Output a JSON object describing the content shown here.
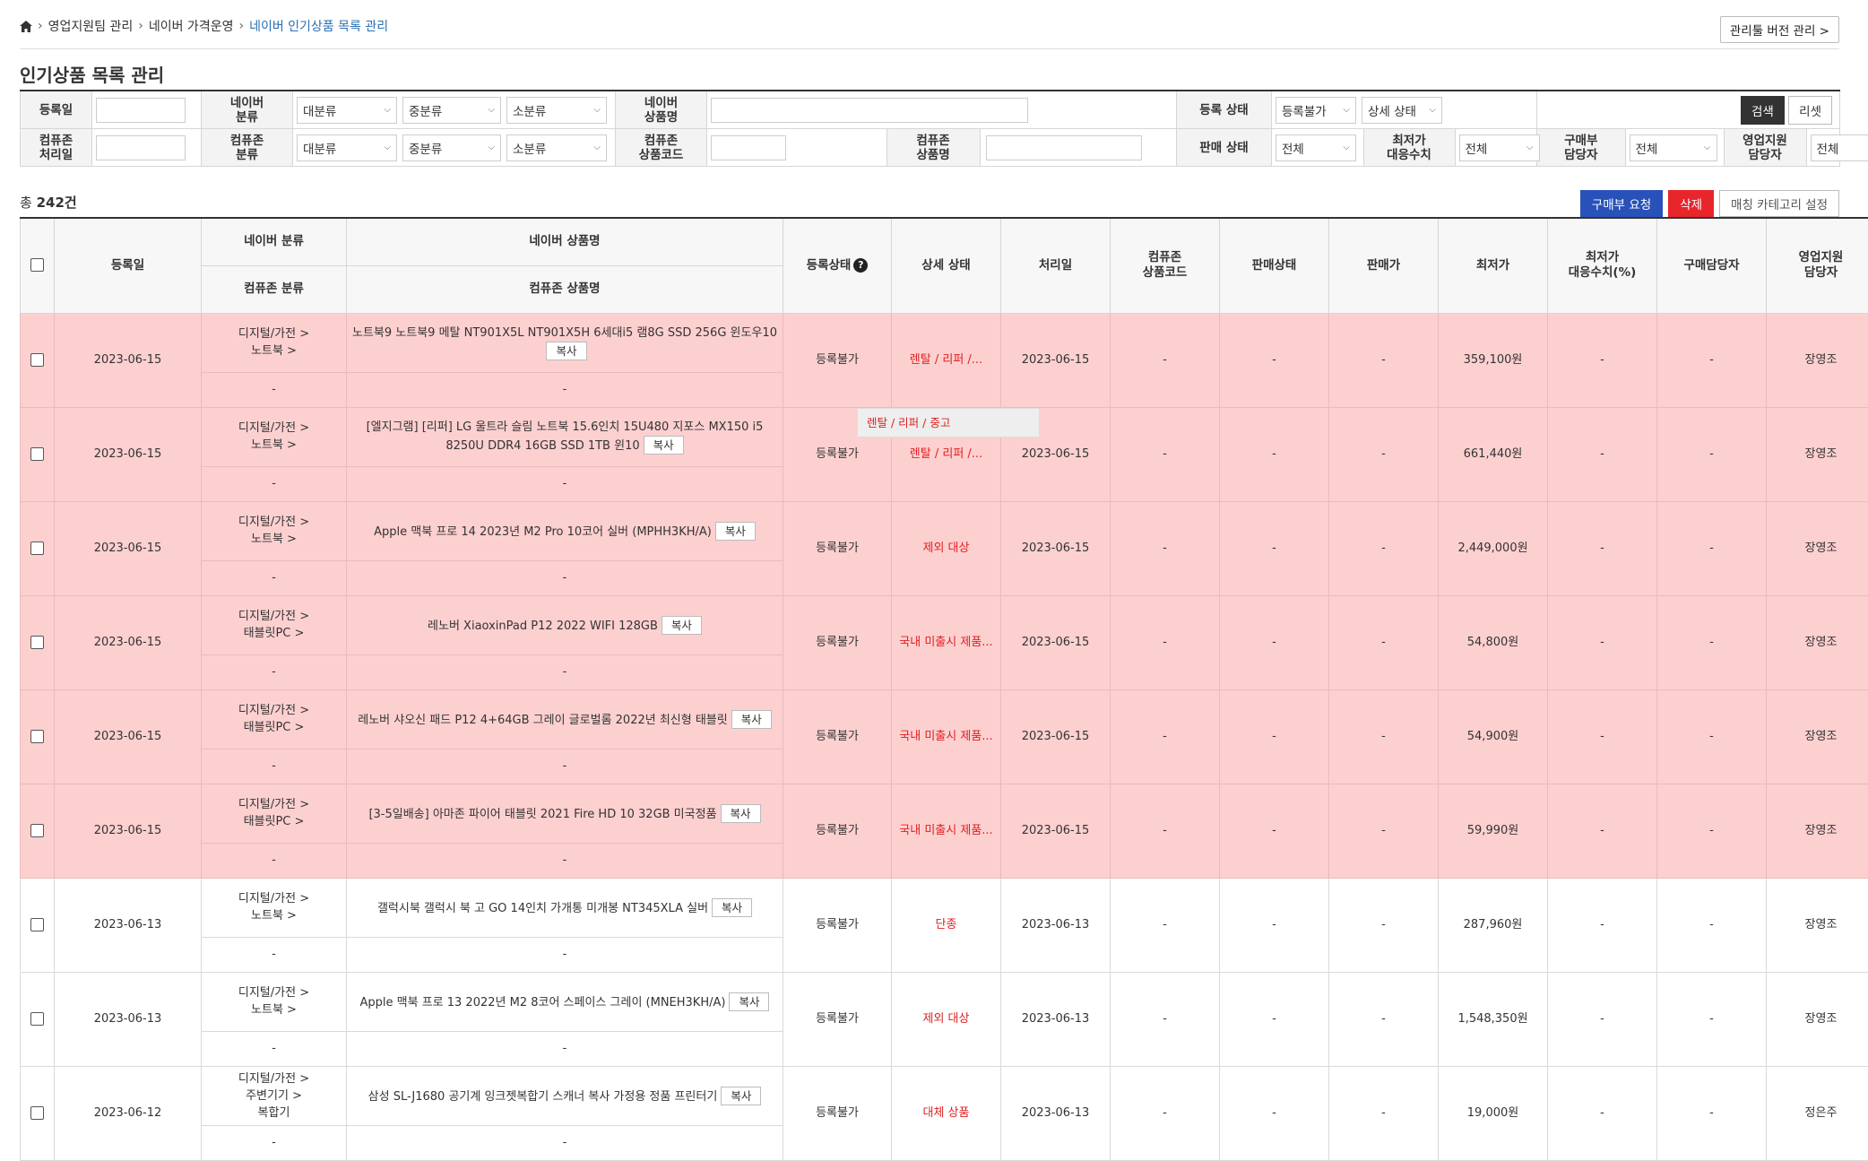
{
  "breadcrumb": [
    "영업지원팀 관리",
    "네이버 가격운영",
    "네이버 인기상품 목록 관리"
  ],
  "version_button": "관리툴 버전 관리 >",
  "page_title": "인기상품 목록 관리",
  "filter": {
    "reg_date": "등록일",
    "naver_cat": "네이버\n분류",
    "naver_name": "네이버\n상품명",
    "reg_status": "등록 상태",
    "reg_status_value": "등록불가",
    "detail_status_value": "상세 상태",
    "cpz_date": "컴퓨존\n처리일",
    "cpz_cat": "컴퓨존\n분류",
    "cpz_code": "컴퓨존\n상품코드",
    "cpz_name": "컴퓨존\n상품명",
    "sale_status": "판매 상태",
    "lowest": "최저가\n대응수치",
    "buyer": "구매부\n담당자",
    "sales_mgr": "영업지원\n담당자",
    "big": "대분류",
    "mid": "중분류",
    "small": "소분류",
    "all": "전체",
    "search": "검색",
    "reset": "리셋"
  },
  "total_prefix": "총",
  "total_count": "242건",
  "actions": {
    "request": "구매부 요청",
    "delete": "삭제",
    "match": "매칭 카테고리 설정"
  },
  "headers": {
    "reg_date": "등록일",
    "naver_cat": "네이버 분류",
    "naver_name": "네이버 상품명",
    "cpz_cat": "컴퓨존 분류",
    "cpz_name": "컴퓨존 상품명",
    "reg_status": "등록상태",
    "detail": "상세 상태",
    "proc_date": "처리일",
    "cpz_code": "컴퓨존\n상품코드",
    "sale_status": "판매상태",
    "sale_price": "판매가",
    "lowest": "최저가",
    "lowest_ratio": "최저가\n대응수치(%)",
    "buyer": "구매담당자",
    "sales_mgr": "영업지원\n담당자"
  },
  "copy_label": "복사",
  "tooltip": "렌탈 / 리퍼 / 중고",
  "rows": [
    {
      "date": "2023-06-15",
      "cat": "디지털/가전 >\n노트북 >",
      "name": "노트북9 노트북9 메탈 NT901X5L NT901X5H 6세대i5 램8G SSD 256G 윈도우10",
      "status": "등록불가",
      "detail": "렌탈 / 리퍼 /...",
      "proc": "2023-06-15",
      "code": "-",
      "sale": "-",
      "price": "-",
      "lowest": "359,100원",
      "ratio": "-",
      "buyer": "-",
      "mgr": "장영조",
      "cpz_cat": "-",
      "cpz_name": "-",
      "hl": true
    },
    {
      "date": "2023-06-15",
      "cat": "디지털/가전 >\n노트북 >",
      "name": "[엘지그램] [리퍼] LG 울트라 슬림 노트북 15.6인치 15U480 지포스 MX150 i5 8250U DDR4 16GB SSD 1TB 윈10",
      "status": "등록불가",
      "detail": "렌탈 / 리퍼 /...",
      "proc": "2023-06-15",
      "code": "-",
      "sale": "-",
      "price": "-",
      "lowest": "661,440원",
      "ratio": "-",
      "buyer": "-",
      "mgr": "장영조",
      "cpz_cat": "-",
      "cpz_name": "-",
      "hl": true
    },
    {
      "date": "2023-06-15",
      "cat": "디지털/가전 >\n노트북 >",
      "name": "Apple 맥북 프로 14 2023년 M2 Pro 10코어 실버 (MPHH3KH/A)",
      "status": "등록불가",
      "detail": "제외 대상",
      "proc": "2023-06-15",
      "code": "-",
      "sale": "-",
      "price": "-",
      "lowest": "2,449,000원",
      "ratio": "-",
      "buyer": "-",
      "mgr": "장영조",
      "cpz_cat": "-",
      "cpz_name": "-",
      "hl": true
    },
    {
      "date": "2023-06-15",
      "cat": "디지털/가전 >\n태블릿PC >",
      "name": "레노버 XiaoxinPad P12 2022 WIFI 128GB",
      "status": "등록불가",
      "detail": "국내 미출시 제품...",
      "proc": "2023-06-15",
      "code": "-",
      "sale": "-",
      "price": "-",
      "lowest": "54,800원",
      "ratio": "-",
      "buyer": "-",
      "mgr": "장영조",
      "cpz_cat": "-",
      "cpz_name": "-",
      "hl": true
    },
    {
      "date": "2023-06-15",
      "cat": "디지털/가전 >\n태블릿PC >",
      "name": "레노버 샤오신 패드 P12 4+64GB 그레이 글로벌롬 2022년 최신형 태블릿",
      "status": "등록불가",
      "detail": "국내 미출시 제품...",
      "proc": "2023-06-15",
      "code": "-",
      "sale": "-",
      "price": "-",
      "lowest": "54,900원",
      "ratio": "-",
      "buyer": "-",
      "mgr": "장영조",
      "cpz_cat": "-",
      "cpz_name": "-",
      "hl": true
    },
    {
      "date": "2023-06-15",
      "cat": "디지털/가전 >\n태블릿PC >",
      "name": "[3-5일배송] 아마존 파이어 태블릿 2021 Fire HD 10 32GB 미국정품",
      "status": "등록불가",
      "detail": "국내 미출시 제품...",
      "proc": "2023-06-15",
      "code": "-",
      "sale": "-",
      "price": "-",
      "lowest": "59,990원",
      "ratio": "-",
      "buyer": "-",
      "mgr": "장영조",
      "cpz_cat": "-",
      "cpz_name": "-",
      "hl": true
    },
    {
      "date": "2023-06-13",
      "cat": "디지털/가전 >\n노트북 >",
      "name": "갤럭시북 갤럭시 북 고 GO 14인치 가개통 미개봉 NT345XLA 실버",
      "status": "등록불가",
      "detail": "단종",
      "proc": "2023-06-13",
      "code": "-",
      "sale": "-",
      "price": "-",
      "lowest": "287,960원",
      "ratio": "-",
      "buyer": "-",
      "mgr": "장영조",
      "cpz_cat": "-",
      "cpz_name": "-",
      "hl": false
    },
    {
      "date": "2023-06-13",
      "cat": "디지털/가전 >\n노트북 >",
      "name": "Apple 맥북 프로 13 2022년 M2 8코어 스페이스 그레이 (MNEH3KH/A)",
      "status": "등록불가",
      "detail": "제외 대상",
      "proc": "2023-06-13",
      "code": "-",
      "sale": "-",
      "price": "-",
      "lowest": "1,548,350원",
      "ratio": "-",
      "buyer": "-",
      "mgr": "장영조",
      "cpz_cat": "-",
      "cpz_name": "-",
      "hl": false
    },
    {
      "date": "2023-06-12",
      "cat": "디지털/가전 >\n주변기기 >\n복합기",
      "name": "삼성 SL-J1680 공기계 잉크젯복합기 스캐너 복사 가정용 정품 프린터기",
      "status": "등록불가",
      "detail": "대체 상품",
      "proc": "2023-06-13",
      "code": "-",
      "sale": "-",
      "price": "-",
      "lowest": "19,000원",
      "ratio": "-",
      "buyer": "-",
      "mgr": "정은주",
      "cpz_cat": "-",
      "cpz_name": "-",
      "hl": false
    }
  ]
}
